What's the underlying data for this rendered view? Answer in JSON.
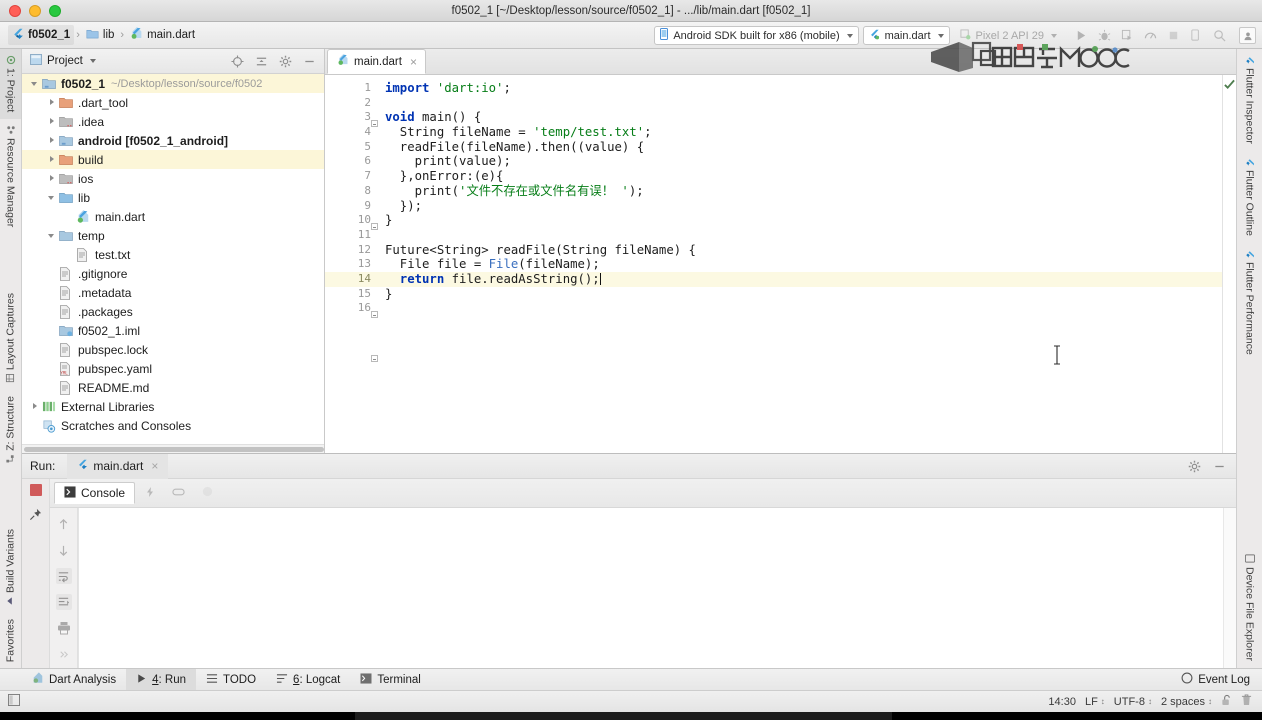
{
  "window": {
    "title": "f0502_1 [~/Desktop/lesson/source/f0502_1] - .../lib/main.dart [f0502_1]"
  },
  "navbar": {
    "breadcrumbs": [
      {
        "label": "f0502_1",
        "icon": "flutter-icon",
        "bold": true
      },
      {
        "label": "lib",
        "icon": "folder-icon",
        "bold": false
      },
      {
        "label": "main.dart",
        "icon": "dart-file-icon",
        "bold": false
      }
    ],
    "separator": "›",
    "device_selector": "Android SDK built for x86 (mobile)",
    "run_config": "main.dart",
    "avd_selector": "Pixel 2 API 29",
    "watermark_text": "中国大学MOOC"
  },
  "left_strip": {
    "top_items": [
      {
        "label": "1: Project",
        "icon": "project-icon",
        "active": true
      },
      {
        "label": "Resource Manager",
        "icon": "resource-icon",
        "active": false
      }
    ],
    "mid_items": [
      {
        "label": "Layout Captures",
        "icon": "layout-captures-icon"
      },
      {
        "label": "Z: Structure",
        "icon": "structure-icon"
      }
    ],
    "bottom_items": [
      {
        "label": "Build Variants",
        "icon": "build-variants-icon"
      },
      {
        "label": "Favorites",
        "icon": "favorites-icon"
      }
    ]
  },
  "right_strip": {
    "top_items": [
      {
        "label": "Flutter Inspector",
        "icon": "flutter-icon"
      },
      {
        "label": "Flutter Outline",
        "icon": "flutter-icon"
      },
      {
        "label": "Flutter Performance",
        "icon": "flutter-icon"
      }
    ],
    "bottom_items": [
      {
        "label": "Device File Explorer",
        "icon": "device-icon"
      }
    ]
  },
  "project_panel": {
    "title": "Project",
    "actions": [
      "locate-icon",
      "collapse-all-icon",
      "settings-gear-icon",
      "hide-icon"
    ],
    "tree": [
      {
        "label": "f0502_1",
        "sub": "~/Desktop/lesson/source/f0502",
        "indent": 0,
        "arrow": "down",
        "icon": "module-icon",
        "bold": true,
        "highlight": true
      },
      {
        "label": ".dart_tool",
        "sub": "",
        "indent": 1,
        "arrow": "right",
        "icon": "folder-orange-icon",
        "bold": false,
        "highlight": false
      },
      {
        "label": ".idea",
        "sub": "",
        "indent": 1,
        "arrow": "right",
        "icon": "folder-excluded-icon",
        "bold": false,
        "highlight": false
      },
      {
        "label": "android [f0502_1_android]",
        "sub": "",
        "indent": 1,
        "arrow": "right",
        "icon": "module-icon",
        "bold": true,
        "highlight": false
      },
      {
        "label": "build",
        "sub": "",
        "indent": 1,
        "arrow": "right",
        "icon": "folder-orange-icon",
        "bold": false,
        "highlight": true
      },
      {
        "label": "ios",
        "sub": "",
        "indent": 1,
        "arrow": "right",
        "icon": "folder-excluded-icon",
        "bold": false,
        "highlight": false
      },
      {
        "label": "lib",
        "sub": "",
        "indent": 1,
        "arrow": "down",
        "icon": "folder-blue-icon",
        "bold": false,
        "highlight": false
      },
      {
        "label": "main.dart",
        "sub": "",
        "indent": 2,
        "arrow": "none",
        "icon": "dart-file-icon",
        "bold": false,
        "highlight": false
      },
      {
        "label": "temp",
        "sub": "",
        "indent": 1,
        "arrow": "down",
        "icon": "folder-icon",
        "bold": false,
        "highlight": false
      },
      {
        "label": "test.txt",
        "sub": "",
        "indent": 2,
        "arrow": "none",
        "icon": "text-file-icon",
        "bold": false,
        "highlight": false
      },
      {
        "label": ".gitignore",
        "sub": "",
        "indent": 1,
        "arrow": "none",
        "icon": "text-file-icon",
        "bold": false,
        "highlight": false
      },
      {
        "label": ".metadata",
        "sub": "",
        "indent": 1,
        "arrow": "none",
        "icon": "text-file-icon",
        "bold": false,
        "highlight": false
      },
      {
        "label": ".packages",
        "sub": "",
        "indent": 1,
        "arrow": "none",
        "icon": "text-file-icon",
        "bold": false,
        "highlight": false
      },
      {
        "label": "f0502_1.iml",
        "sub": "",
        "indent": 1,
        "arrow": "none",
        "icon": "iml-file-icon",
        "bold": false,
        "highlight": false
      },
      {
        "label": "pubspec.lock",
        "sub": "",
        "indent": 1,
        "arrow": "none",
        "icon": "text-file-icon",
        "bold": false,
        "highlight": false
      },
      {
        "label": "pubspec.yaml",
        "sub": "",
        "indent": 1,
        "arrow": "none",
        "icon": "yaml-file-icon",
        "bold": false,
        "highlight": false
      },
      {
        "label": "README.md",
        "sub": "",
        "indent": 1,
        "arrow": "none",
        "icon": "text-file-icon",
        "bold": false,
        "highlight": false
      },
      {
        "label": "External Libraries",
        "sub": "",
        "indent": 0,
        "arrow": "right",
        "icon": "libraries-icon",
        "bold": false,
        "highlight": false
      },
      {
        "label": "Scratches and Consoles",
        "sub": "",
        "indent": 0,
        "arrow": "none",
        "icon": "scratches-icon",
        "bold": false,
        "highlight": false
      }
    ]
  },
  "editor": {
    "tabs": [
      {
        "label": "main.dart",
        "icon": "dart-file-icon",
        "close": "×",
        "active": true
      }
    ],
    "current_line": 14,
    "total_lines": 16,
    "line_numbers": [
      "1",
      "2",
      "3",
      "4",
      "5",
      "6",
      "7",
      "8",
      "9",
      "10",
      "11",
      "12",
      "13",
      "14",
      "15",
      "16"
    ],
    "code_lines": [
      {
        "n": 1,
        "tokens": [
          {
            "t": "import ",
            "c": "kw"
          },
          {
            "t": "'dart:io'",
            "c": "str"
          },
          {
            "t": ";",
            "c": "pln"
          }
        ]
      },
      {
        "n": 2,
        "tokens": [
          {
            "t": "",
            "c": "pln"
          }
        ]
      },
      {
        "n": 3,
        "tokens": [
          {
            "t": "void ",
            "c": "kw"
          },
          {
            "t": "main() {",
            "c": "pln"
          }
        ]
      },
      {
        "n": 4,
        "tokens": [
          {
            "t": "  String fileName = ",
            "c": "pln"
          },
          {
            "t": "'temp/test.txt'",
            "c": "str"
          },
          {
            "t": ";",
            "c": "pln"
          }
        ]
      },
      {
        "n": 5,
        "tokens": [
          {
            "t": "  readFile(fileName).then((value) {",
            "c": "pln"
          }
        ]
      },
      {
        "n": 6,
        "tokens": [
          {
            "t": "    print(value);",
            "c": "pln"
          }
        ]
      },
      {
        "n": 7,
        "tokens": [
          {
            "t": "  },onError:(e){",
            "c": "pln"
          }
        ]
      },
      {
        "n": 8,
        "tokens": [
          {
            "t": "    print(",
            "c": "pln"
          },
          {
            "t": "'文件不存在或文件名有误！ '",
            "c": "str"
          },
          {
            "t": ");",
            "c": "pln"
          }
        ]
      },
      {
        "n": 9,
        "tokens": [
          {
            "t": "  });",
            "c": "pln"
          }
        ]
      },
      {
        "n": 10,
        "tokens": [
          {
            "t": "}",
            "c": "pln"
          }
        ]
      },
      {
        "n": 11,
        "tokens": [
          {
            "t": "",
            "c": "pln"
          }
        ]
      },
      {
        "n": 12,
        "tokens": [
          {
            "t": "Future<String> readFile(String fileName) {",
            "c": "pln"
          }
        ]
      },
      {
        "n": 13,
        "tokens": [
          {
            "t": "  File file = ",
            "c": "pln"
          },
          {
            "t": "File",
            "c": "typ"
          },
          {
            "t": "(fileName);",
            "c": "pln"
          }
        ]
      },
      {
        "n": 14,
        "tokens": [
          {
            "t": "  return ",
            "c": "kw"
          },
          {
            "t": "file.readAsString();",
            "c": "pln"
          }
        ]
      },
      {
        "n": 15,
        "tokens": [
          {
            "t": "}",
            "c": "pln"
          }
        ]
      },
      {
        "n": 16,
        "tokens": [
          {
            "t": "",
            "c": "pln"
          }
        ]
      }
    ],
    "inspection_status": "ok-check-icon"
  },
  "run_panel": {
    "label": "Run:",
    "tab": "main.dart",
    "close": "×",
    "subtabs": [
      {
        "label": "Console",
        "icon": "console-icon",
        "active": true
      },
      {
        "label": "",
        "icon": "bolt-icon",
        "active": false
      },
      {
        "label": "",
        "icon": "stack-icon",
        "active": false
      },
      {
        "label": "",
        "icon": "filter-icon",
        "active": false
      }
    ],
    "side_actions": [
      "up-arrow-icon",
      "down-arrow-icon",
      "soft-wrap-icon",
      "scroll-end-icon",
      "print-icon",
      "more-icon"
    ],
    "head_actions": [
      "settings-gear-icon",
      "hide-icon"
    ],
    "output": ""
  },
  "toolwindow_bar": {
    "items": [
      {
        "label": "Dart Analysis",
        "icon": "dart-icon",
        "num": "",
        "active": false
      },
      {
        "label": ": Run",
        "icon": "run-icon",
        "num": "4",
        "active": true
      },
      {
        "label": "TODO",
        "icon": "todo-icon",
        "num": "",
        "active": false
      },
      {
        "label": ": Logcat",
        "icon": "logcat-icon",
        "num": "6",
        "active": false
      },
      {
        "label": "Terminal",
        "icon": "terminal-icon",
        "num": "",
        "active": false
      }
    ],
    "event_log": "Event Log",
    "event_log_icon": "event-log-icon"
  },
  "statusbar": {
    "left_icon": "layout-icon",
    "message": "",
    "caret_position": "14:30",
    "line_separator": "LF",
    "encoding": "UTF-8",
    "indent": "2 spaces",
    "lock_icon": "unlock-icon",
    "trash_icon": "trash-icon"
  },
  "colors": {
    "accent_blue": "#3a6fbf",
    "keyword": "#0033b3",
    "string": "#067d17",
    "highlight_row": "#fcf6d8",
    "current_line": "#fcf9e2",
    "run_stop": "#d05a5a"
  }
}
